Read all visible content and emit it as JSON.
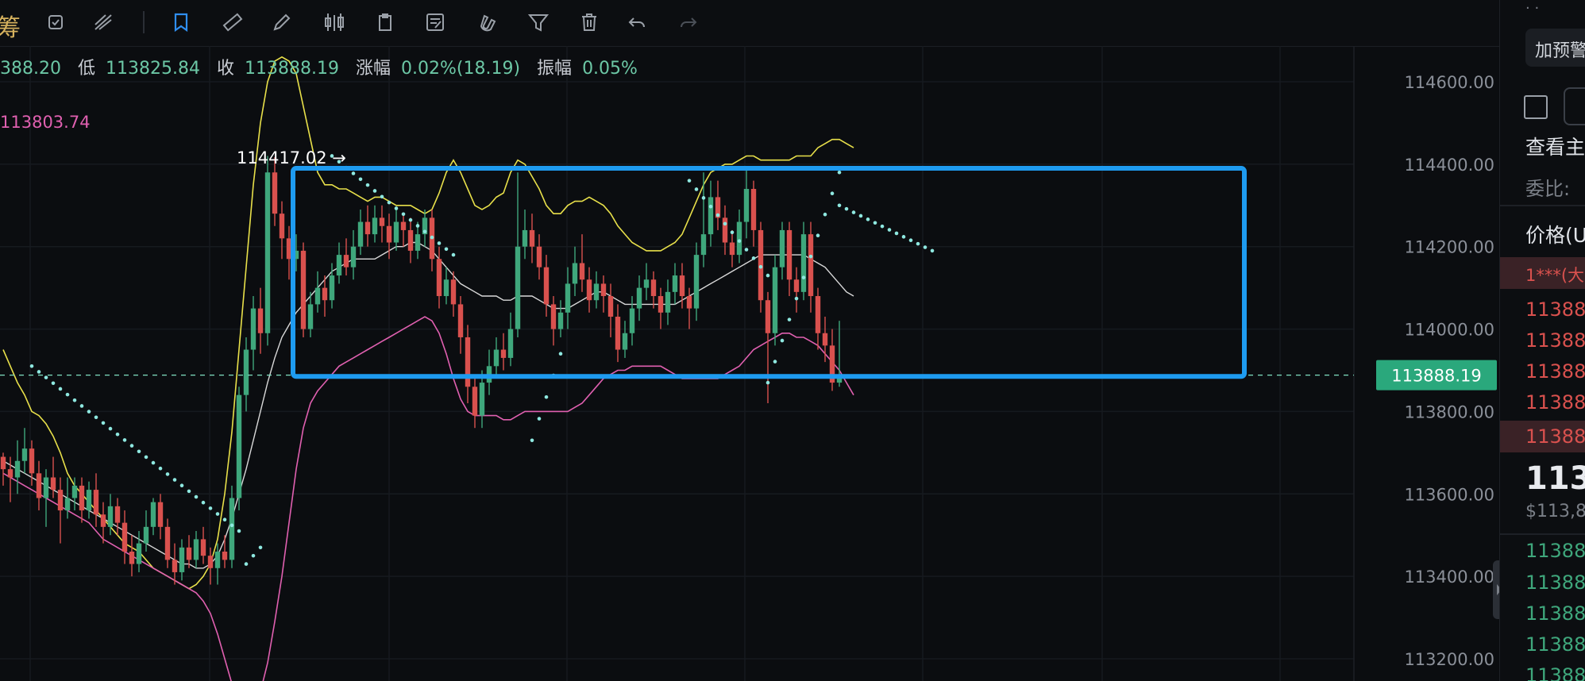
{
  "toolbar": {
    "left_fragment": "筹",
    "tools": [
      "settings-icon",
      "draw-lines-icon",
      "bookmark-icon",
      "ruler-icon",
      "pen-icon",
      "candle-pattern-icon",
      "clipboard-icon",
      "note-icon",
      "magnet-icon",
      "filter-icon",
      "trash-icon",
      "undo-icon",
      "redo-icon"
    ]
  },
  "ohlc": {
    "open_fragment": "388.20",
    "low_label": "低",
    "low": "113825.84",
    "close_label": "收",
    "close": "113888.19",
    "change_label": "涨幅",
    "change": "0.02%(18.19)",
    "amp_label": "振幅",
    "amp": "0.05%"
  },
  "indicator_value": "113803.74",
  "annotation": {
    "price": "114417.02",
    "arrow": "→"
  },
  "price_axis": {
    "ticks": [
      "114600.00",
      "114400.00",
      "114200.00",
      "114000.00",
      "113800.00",
      "113600.00",
      "113400.00",
      "113200.00"
    ],
    "current": "113888.19"
  },
  "colors": {
    "up": "#3fa77c",
    "down": "#d9514e",
    "upper_band": "#e8e04a",
    "lower_band": "#e060b0",
    "mid_band": "#d9d9d9",
    "sar": "#8ee8e0",
    "box": "#1e9bf0",
    "price_tag": "#2aa87c"
  },
  "chart_data": {
    "type": "candlestick",
    "ylim": [
      113120,
      114700
    ],
    "y_ticks": [
      114600,
      114400,
      114200,
      114000,
      113800,
      113600,
      113400,
      113200
    ],
    "candles": [
      [
        113690,
        113660,
        113700,
        113620
      ],
      [
        113660,
        113640,
        113690,
        113580
      ],
      [
        113640,
        113680,
        113730,
        113600
      ],
      [
        113680,
        113710,
        113760,
        113650
      ],
      [
        113710,
        113650,
        113730,
        113620
      ],
      [
        113650,
        113590,
        113680,
        113560
      ],
      [
        113590,
        113640,
        113660,
        113520
      ],
      [
        113640,
        113610,
        113690,
        113590
      ],
      [
        113610,
        113560,
        113640,
        113480
      ],
      [
        113560,
        113590,
        113640,
        113540
      ],
      [
        113590,
        113620,
        113640,
        113560
      ],
      [
        113620,
        113560,
        113640,
        113530
      ],
      [
        113560,
        113610,
        113630,
        113540
      ],
      [
        113610,
        113550,
        113650,
        113520
      ],
      [
        113550,
        113520,
        113580,
        113480
      ],
      [
        113520,
        113570,
        113600,
        113500
      ],
      [
        113570,
        113530,
        113590,
        113500
      ],
      [
        113530,
        113460,
        113560,
        113430
      ],
      [
        113460,
        113430,
        113500,
        113400
      ],
      [
        113430,
        113480,
        113510,
        113410
      ],
      [
        113480,
        113520,
        113560,
        113460
      ],
      [
        113520,
        113580,
        113590,
        113500
      ],
      [
        113580,
        113520,
        113600,
        113490
      ],
      [
        113520,
        113440,
        113540,
        113420
      ],
      [
        113440,
        113410,
        113480,
        113380
      ],
      [
        113410,
        113470,
        113490,
        113390
      ],
      [
        113470,
        113440,
        113500,
        113420
      ],
      [
        113440,
        113490,
        113510,
        113420
      ],
      [
        113490,
        113450,
        113520,
        113430
      ],
      [
        113450,
        113420,
        113470,
        113380
      ],
      [
        113420,
        113460,
        113480,
        113380
      ],
      [
        113460,
        113440,
        113500,
        113420
      ],
      [
        113440,
        113590,
        113620,
        113420
      ],
      [
        113590,
        113840,
        113860,
        113560
      ],
      [
        113840,
        113950,
        113980,
        113800
      ],
      [
        113950,
        114050,
        114080,
        113900
      ],
      [
        114050,
        113990,
        114100,
        113940
      ],
      [
        113990,
        114380,
        114420,
        113960
      ],
      [
        114380,
        114280,
        114417,
        114250
      ],
      [
        114280,
        114220,
        114310,
        114170
      ],
      [
        114220,
        114170,
        114250,
        114120
      ],
      [
        114170,
        114190,
        114230,
        114140
      ],
      [
        114190,
        114000,
        114210,
        113980
      ],
      [
        114000,
        114060,
        114090,
        113980
      ],
      [
        114060,
        114100,
        114140,
        114040
      ],
      [
        114100,
        114070,
        114130,
        114030
      ],
      [
        114070,
        114130,
        114160,
        114050
      ],
      [
        114130,
        114180,
        114210,
        114110
      ],
      [
        114180,
        114150,
        114220,
        114130
      ],
      [
        114150,
        114200,
        114240,
        114120
      ],
      [
        114200,
        114260,
        114290,
        114180
      ],
      [
        114260,
        114230,
        114300,
        114200
      ],
      [
        114230,
        114270,
        114300,
        114210
      ],
      [
        114270,
        114250,
        114300,
        114210
      ],
      [
        114250,
        114210,
        114280,
        114170
      ],
      [
        114210,
        114260,
        114290,
        114190
      ],
      [
        114260,
        114240,
        114280,
        114200
      ],
      [
        114240,
        114190,
        114270,
        114160
      ],
      [
        114190,
        114230,
        114260,
        114170
      ],
      [
        114230,
        114270,
        114290,
        114200
      ],
      [
        114270,
        114170,
        114290,
        114140
      ],
      [
        114170,
        114080,
        114200,
        114050
      ],
      [
        114080,
        114120,
        114150,
        114060
      ],
      [
        114120,
        114060,
        114140,
        114030
      ],
      [
        114060,
        113980,
        114080,
        113940
      ],
      [
        113980,
        113860,
        114010,
        113820
      ],
      [
        113860,
        113790,
        113880,
        113760
      ],
      [
        113790,
        113870,
        113900,
        113760
      ],
      [
        113870,
        113910,
        113950,
        113840
      ],
      [
        113910,
        113950,
        113980,
        113880
      ],
      [
        113950,
        113930,
        113990,
        113900
      ],
      [
        113930,
        114000,
        114040,
        113910
      ],
      [
        114000,
        114200,
        114380,
        113980
      ],
      [
        114200,
        114240,
        114290,
        114170
      ],
      [
        114240,
        114200,
        114280,
        114160
      ],
      [
        114200,
        114150,
        114230,
        114120
      ],
      [
        114150,
        114060,
        114180,
        114030
      ],
      [
        114060,
        114000,
        114080,
        113960
      ],
      [
        114000,
        114040,
        114070,
        113980
      ],
      [
        114040,
        114110,
        114150,
        114000
      ],
      [
        114110,
        114160,
        114200,
        114080
      ],
      [
        114160,
        114120,
        114230,
        114090
      ],
      [
        114120,
        114070,
        114150,
        114040
      ],
      [
        114070,
        114110,
        114140,
        114050
      ],
      [
        114110,
        114080,
        114130,
        114040
      ],
      [
        114080,
        114030,
        114110,
        113980
      ],
      [
        114030,
        113950,
        114060,
        113920
      ],
      [
        113950,
        113990,
        114020,
        113930
      ],
      [
        113990,
        114050,
        114080,
        113960
      ],
      [
        114050,
        114100,
        114130,
        114020
      ],
      [
        114100,
        114120,
        114160,
        114070
      ],
      [
        114120,
        114080,
        114140,
        114050
      ],
      [
        114080,
        114040,
        114100,
        114000
      ],
      [
        114040,
        114090,
        114120,
        114010
      ],
      [
        114090,
        114130,
        114160,
        114060
      ],
      [
        114130,
        114080,
        114160,
        114050
      ],
      [
        114080,
        114050,
        114100,
        114000
      ],
      [
        114050,
        114180,
        114210,
        114020
      ],
      [
        114180,
        114230,
        114380,
        114150
      ],
      [
        114230,
        114320,
        114360,
        114200
      ],
      [
        114320,
        114270,
        114360,
        114240
      ],
      [
        114270,
        114210,
        114300,
        114180
      ],
      [
        114210,
        114180,
        114240,
        114150
      ],
      [
        114180,
        114260,
        114290,
        114160
      ],
      [
        114260,
        114340,
        114390,
        114220
      ],
      [
        114340,
        114240,
        114360,
        114200
      ],
      [
        114240,
        114070,
        114260,
        114040
      ],
      [
        114070,
        113990,
        114090,
        113820
      ],
      [
        113990,
        114150,
        114180,
        113960
      ],
      [
        114150,
        114240,
        114260,
        114120
      ],
      [
        114240,
        114120,
        114260,
        114080
      ],
      [
        114120,
        114090,
        114150,
        114040
      ],
      [
        114090,
        114230,
        114260,
        114070
      ],
      [
        114230,
        114080,
        114260,
        114040
      ],
      [
        114080,
        113990,
        114100,
        113950
      ],
      [
        113990,
        113960,
        114030,
        113920
      ],
      [
        113960,
        113870,
        114000,
        113850
      ],
      [
        113870,
        113890,
        114020,
        113860
      ]
    ],
    "upper_band": [
      113950,
      113910,
      113870,
      113840,
      113800,
      113790,
      113770,
      113740,
      113700,
      113650,
      113620,
      113600,
      113580,
      113560,
      113540,
      113520,
      113500,
      113480,
      113470,
      113460,
      113440,
      113420,
      113410,
      113400,
      113390,
      113380,
      113370,
      113380,
      113400,
      113430,
      113490,
      113600,
      113750,
      113950,
      114150,
      114350,
      114500,
      114600,
      114650,
      114660,
      114650,
      114620,
      114540,
      114460,
      114380,
      114350,
      114350,
      114340,
      114340,
      114330,
      114320,
      114310,
      114320,
      114320,
      114310,
      114300,
      114300,
      114300,
      114290,
      114280,
      114290,
      114330,
      114380,
      114410,
      114380,
      114340,
      114300,
      114290,
      114300,
      114320,
      114330,
      114380,
      114410,
      114400,
      114370,
      114340,
      114300,
      114280,
      114280,
      114300,
      114310,
      114310,
      114320,
      114310,
      114300,
      114280,
      114250,
      114230,
      114210,
      114200,
      114190,
      114190,
      114190,
      114200,
      114210,
      114230,
      114270,
      114310,
      114350,
      114380,
      114390,
      114400,
      114400,
      114410,
      114420,
      114420,
      114410,
      114410,
      114410,
      114410,
      114410,
      114420,
      114420,
      114420,
      114440,
      114450,
      114460,
      114460,
      114450,
      114440
    ],
    "mid_band": [
      113680,
      113670,
      113660,
      113650,
      113640,
      113630,
      113620,
      113610,
      113600,
      113590,
      113580,
      113570,
      113560,
      113550,
      113540,
      113530,
      113520,
      113510,
      113500,
      113490,
      113480,
      113470,
      113460,
      113450,
      113440,
      113430,
      113430,
      113420,
      113420,
      113430,
      113450,
      113490,
      113540,
      113600,
      113660,
      113730,
      113800,
      113870,
      113930,
      113980,
      114010,
      114040,
      114060,
      114080,
      114100,
      114120,
      114140,
      114150,
      114160,
      114170,
      114170,
      114170,
      114170,
      114180,
      114190,
      114200,
      114200,
      114210,
      114210,
      114200,
      114190,
      114170,
      114150,
      114130,
      114110,
      114100,
      114090,
      114080,
      114080,
      114080,
      114070,
      114070,
      114080,
      114080,
      114080,
      114070,
      114060,
      114050,
      114050,
      114050,
      114060,
      114070,
      114080,
      114090,
      114090,
      114080,
      114070,
      114060,
      114060,
      114060,
      114060,
      114060,
      114060,
      114060,
      114060,
      114070,
      114080,
      114090,
      114100,
      114110,
      114120,
      114130,
      114140,
      114150,
      114160,
      114170,
      114180,
      114180,
      114180,
      114180,
      114180,
      114180,
      114180,
      114170,
      114160,
      114150,
      114130,
      114110,
      114090,
      114080
    ],
    "lower_band": [
      113650,
      113640,
      113630,
      113620,
      113610,
      113600,
      113590,
      113580,
      113570,
      113560,
      113550,
      113540,
      113530,
      113510,
      113490,
      113480,
      113470,
      113460,
      113450,
      113440,
      113430,
      113420,
      113410,
      113400,
      113390,
      113380,
      113370,
      113360,
      113340,
      113310,
      113260,
      113200,
      113140,
      113100,
      113080,
      113090,
      113120,
      113190,
      113290,
      113400,
      113530,
      113660,
      113760,
      113820,
      113850,
      113870,
      113890,
      113910,
      113920,
      113930,
      113940,
      113950,
      113960,
      113970,
      113980,
      113990,
      114000,
      114010,
      114020,
      114030,
      114020,
      113990,
      113940,
      113880,
      113830,
      113800,
      113790,
      113790,
      113790,
      113790,
      113780,
      113780,
      113790,
      113800,
      113800,
      113800,
      113800,
      113800,
      113800,
      113800,
      113810,
      113820,
      113840,
      113860,
      113880,
      113890,
      113900,
      113900,
      113910,
      113910,
      113910,
      113910,
      113910,
      113900,
      113890,
      113880,
      113880,
      113880,
      113880,
      113880,
      113880,
      113890,
      113900,
      113910,
      113930,
      113950,
      113960,
      113970,
      113980,
      113990,
      113990,
      113980,
      113980,
      113970,
      113960,
      113940,
      113920,
      113900,
      113870,
      113840
    ]
  }
}
